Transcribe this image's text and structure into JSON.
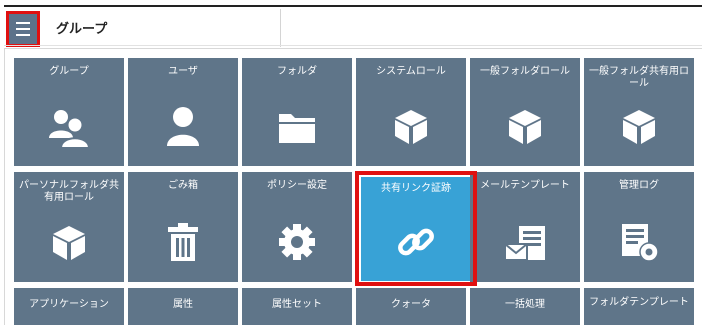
{
  "header": {
    "menu_icon": "hamburger-menu-icon",
    "title": "グループ"
  },
  "tiles_row1": [
    {
      "label": "グループ",
      "icon": "group-users-icon"
    },
    {
      "label": "ユーザ",
      "icon": "user-icon"
    },
    {
      "label": "フォルダ",
      "icon": "folder-icon"
    },
    {
      "label": "システムロール",
      "icon": "cube-icon"
    },
    {
      "label": "一般フォルダロール",
      "icon": "cube-icon"
    },
    {
      "label": "一般フォルダ共有用ロール",
      "icon": "cube-icon"
    }
  ],
  "tiles_row2": [
    {
      "label": "パーソナルフォルダ共有用ロール",
      "icon": "cube-icon"
    },
    {
      "label": "ごみ箱",
      "icon": "trash-icon"
    },
    {
      "label": "ポリシー設定",
      "icon": "gear-icon"
    },
    {
      "label": "共有リンク証跡",
      "icon": "link-icon",
      "active": true
    },
    {
      "label": "メールテンプレート",
      "icon": "mail-template-icon"
    },
    {
      "label": "管理ログ",
      "icon": "log-settings-icon"
    }
  ],
  "tiles_row3": [
    {
      "label": "アプリケーション"
    },
    {
      "label": "属性"
    },
    {
      "label": "属性セット"
    },
    {
      "label": "クォータ"
    },
    {
      "label": "一括処理"
    },
    {
      "label": "フォルダテンプレート"
    }
  ],
  "colors": {
    "tile": "#5f7589",
    "tile_active": "#38a2d6",
    "highlight": "#e01010"
  }
}
